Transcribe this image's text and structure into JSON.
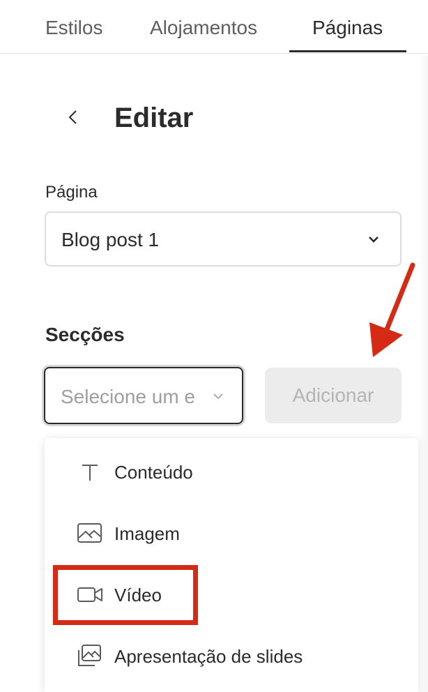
{
  "tabs": [
    {
      "label": "Estilos"
    },
    {
      "label": "Alojamentos"
    },
    {
      "label": "Páginas"
    }
  ],
  "header": {
    "title": "Editar"
  },
  "page_field": {
    "label": "Página",
    "value": "Blog post 1"
  },
  "sections": {
    "label": "Secções",
    "select_placeholder": "Selecione um e",
    "add_button": "Adicionar"
  },
  "menu": {
    "items": [
      {
        "label": "Conteúdo",
        "icon": "text-icon"
      },
      {
        "label": "Imagem",
        "icon": "image-icon"
      },
      {
        "label": "Vídeo",
        "icon": "video-camera-icon"
      },
      {
        "label": "Apresentação de slides",
        "icon": "slideshow-icon"
      }
    ]
  },
  "colors": {
    "annotation_red": "#d52a16",
    "text_dark": "#2b2b2b",
    "disabled_button_bg": "#ececec"
  }
}
